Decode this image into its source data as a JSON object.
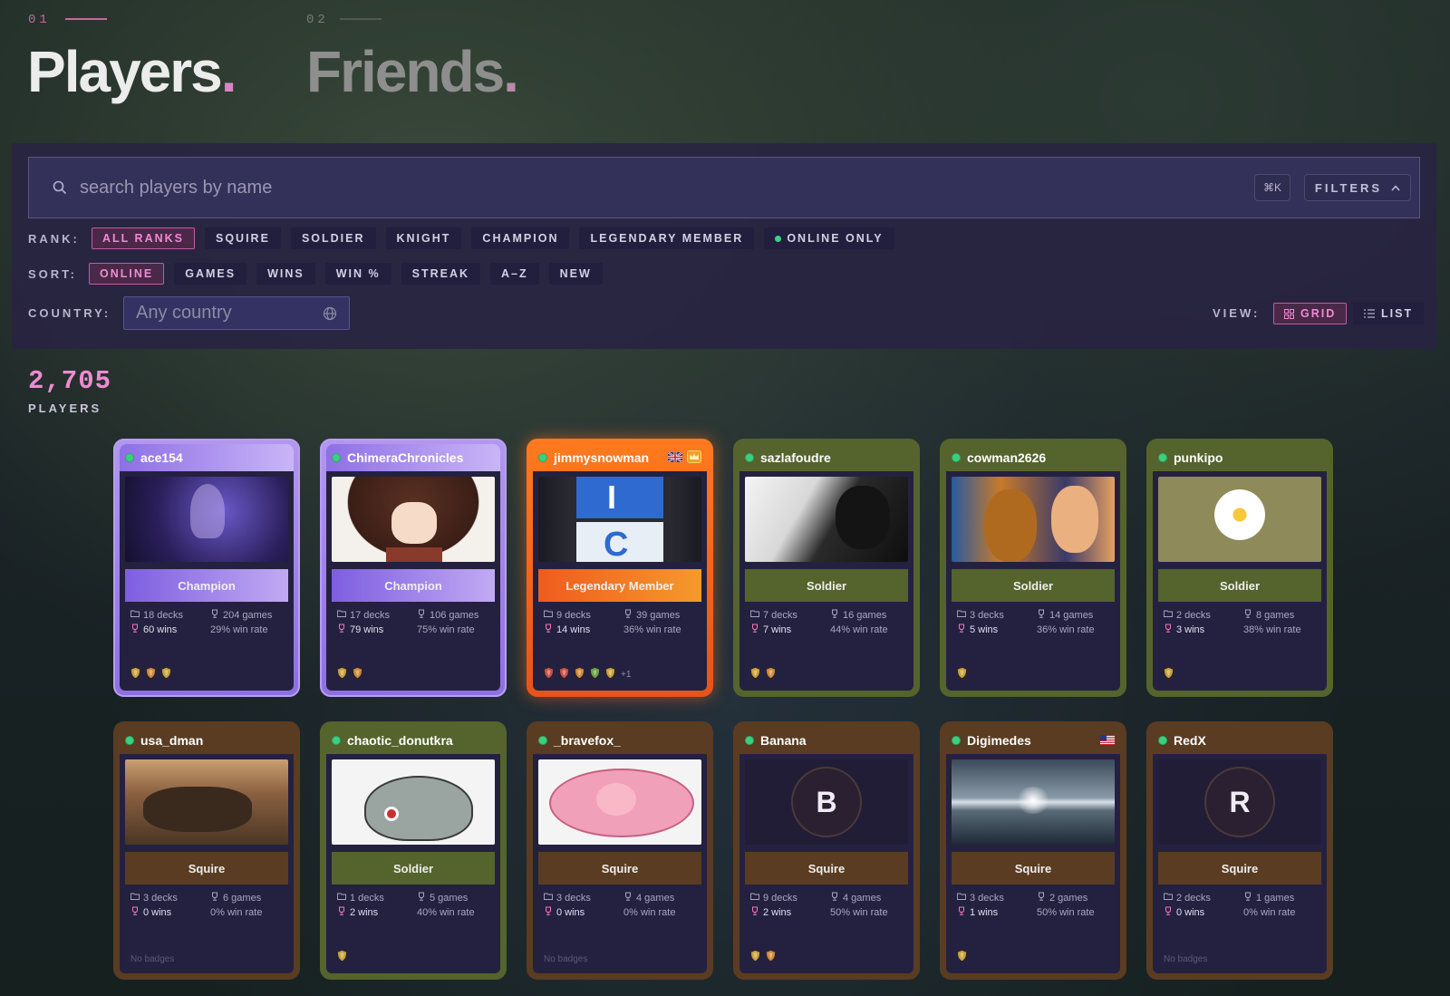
{
  "tabs": [
    {
      "num": "01",
      "title": "Players",
      "dot": "."
    },
    {
      "num": "02",
      "title": "Friends",
      "dot": "."
    }
  ],
  "search": {
    "placeholder": "search players by name",
    "shortcut": "⌘K",
    "filters_label": "FILTERS"
  },
  "rank_filter": {
    "label": "RANK:",
    "options": [
      "ALL RANKS",
      "SQUIRE",
      "SOLDIER",
      "KNIGHT",
      "CHAMPION",
      "LEGENDARY MEMBER"
    ],
    "active": "ALL RANKS",
    "online_only": "ONLINE ONLY"
  },
  "sort": {
    "label": "SORT:",
    "options": [
      "ONLINE",
      "GAMES",
      "WINS",
      "WIN %",
      "STREAK",
      "A–Z",
      "NEW"
    ],
    "active": "ONLINE"
  },
  "country": {
    "label": "COUNTRY:",
    "placeholder": "Any country"
  },
  "view": {
    "label": "VIEW:",
    "grid": "GRID",
    "list": "LIST",
    "active": "GRID"
  },
  "summary": {
    "count": "2,705",
    "label": "PLAYERS"
  },
  "colors": {
    "accent_pink": "#ee8bd2",
    "online_green": "#39d07f",
    "champion": "#a68aee",
    "legendary": "#f06a1e",
    "soldier": "#55632c",
    "squire": "#5a3c22"
  },
  "players": [
    {
      "name": "ace154",
      "rank": "Champion",
      "tier": "champion",
      "decks": "18 decks",
      "games": "204 games",
      "wins": "60 wins",
      "rate": "29% win rate",
      "badges": [
        "shield-gold",
        "shield-orange",
        "shield-gold"
      ],
      "extra": "",
      "flag": "",
      "avatar": "dark-purple-art"
    },
    {
      "name": "ChimeraChronicles",
      "rank": "Champion",
      "tier": "champion",
      "decks": "17 decks",
      "games": "106 games",
      "wins": "79 wins",
      "rate": "75% win rate",
      "badges": [
        "shield-gold",
        "shield-orange"
      ],
      "extra": "",
      "flag": "",
      "avatar": "anime-girl"
    },
    {
      "name": "jimmysnowman",
      "rank": "Legendary Member",
      "tier": "legendary",
      "decks": "9 decks",
      "games": "39 games",
      "wins": "14 wins",
      "rate": "36% win rate",
      "badges": [
        "shield-red",
        "shield-red",
        "shield-orange",
        "shield-green",
        "shield-gold"
      ],
      "extra": "+1",
      "flag": "uk",
      "avatar": "blue-sign"
    },
    {
      "name": "sazlafoudre",
      "rank": "Soldier",
      "tier": "soldier",
      "decks": "7 decks",
      "games": "16 games",
      "wins": "7 wins",
      "rate": "44% win rate",
      "badges": [
        "shield-gold",
        "shield-orange"
      ],
      "extra": "",
      "flag": "",
      "avatar": "bw-manga"
    },
    {
      "name": "cowman2626",
      "rank": "Soldier",
      "tier": "soldier",
      "decks": "3 decks",
      "games": "14 games",
      "wins": "5 wins",
      "rate": "36% win rate",
      "badges": [
        "shield-gold"
      ],
      "extra": "",
      "flag": "",
      "avatar": "comic-faces"
    },
    {
      "name": "punkipo",
      "rank": "Soldier",
      "tier": "soldier",
      "decks": "2 decks",
      "games": "8 games",
      "wins": "3 wins",
      "rate": "38% win rate",
      "badges": [
        "shield-gold"
      ],
      "extra": "",
      "flag": "",
      "avatar": "water-lily"
    },
    {
      "name": "usa_dman",
      "rank": "Squire",
      "tier": "squire",
      "decks": "3 decks",
      "games": "6 games",
      "wins": "0 wins",
      "rate": "0% win rate",
      "badges": [],
      "extra": "",
      "no_badges": "No badges",
      "flag": "",
      "avatar": "desert-photo"
    },
    {
      "name": "chaotic_donutkra",
      "rank": "Soldier",
      "tier": "soldier",
      "decks": "1 decks",
      "games": "5 games",
      "wins": "2 wins",
      "rate": "40% win rate",
      "badges": [
        "shield-gold"
      ],
      "extra": "",
      "flag": "",
      "avatar": "whale-cartoon"
    },
    {
      "name": "_bravefox_",
      "rank": "Squire",
      "tier": "squire",
      "decks": "3 decks",
      "games": "4 games",
      "wins": "0 wins",
      "rate": "0% win rate",
      "badges": [],
      "extra": "",
      "no_badges": "No badges",
      "flag": "",
      "avatar": "pink-creature"
    },
    {
      "name": "Banana",
      "rank": "Squire",
      "tier": "squire",
      "decks": "9 decks",
      "games": "4 games",
      "wins": "2 wins",
      "rate": "50% win rate",
      "badges": [
        "shield-gold",
        "shield-orange"
      ],
      "extra": "",
      "flag": "",
      "avatar_letter": "B"
    },
    {
      "name": "Digimedes",
      "rank": "Squire",
      "tier": "squire",
      "decks": "3 decks",
      "games": "2 games",
      "wins": "1 wins",
      "rate": "50% win rate",
      "badges": [
        "shield-gold"
      ],
      "extra": "",
      "flag": "us",
      "avatar": "sea-sky"
    },
    {
      "name": "RedX",
      "rank": "Squire",
      "tier": "squire",
      "decks": "2 decks",
      "games": "1 games",
      "wins": "0 wins",
      "rate": "0% win rate",
      "badges": [],
      "extra": "",
      "no_badges": "No badges",
      "flag": "",
      "avatar_letter": "R"
    }
  ]
}
